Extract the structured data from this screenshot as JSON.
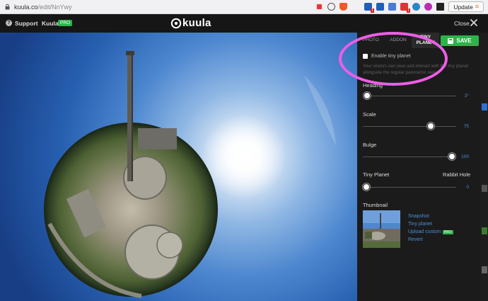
{
  "browser": {
    "url_host": "kuula.co",
    "url_path": "/edit/NnYwy",
    "update_label": "Update"
  },
  "header": {
    "help_glyph": "?",
    "support": "Support",
    "kuula_label": "Kuula",
    "pro": "PRO",
    "logo_text": "kuula",
    "close": "Close"
  },
  "panel": {
    "tabs": [
      "PHOTO",
      "ADDON",
      "TINY PLANET"
    ],
    "active_tab": "TINY PLANET",
    "save": "SAVE",
    "enable_label": "Enable tiny planet",
    "description": "Your visitors can view and interact with the tiny planet alongside the regular panoramic view.",
    "heading": {
      "label": "Heading",
      "value": "3°",
      "level": 0.03
    },
    "scale": {
      "label": "Scale",
      "value": "75",
      "level": 0.75
    },
    "bulge": {
      "label": "Bulge",
      "value": "100",
      "level": 1.0
    },
    "blend": {
      "left_label": "Tiny Planet",
      "right_label": "Rabbit Hole",
      "value": "0",
      "level": 0
    },
    "thumbnail_label": "Thumbnail",
    "links": {
      "snapshot": "Snapshot",
      "tiny_planet": "Tiny planet",
      "upload_custom": "Upload custom",
      "pro": "PRO",
      "revert": "Revert"
    }
  },
  "colors": {
    "accent_green": "#2db34a",
    "link_blue": "#4a8fd8",
    "highlight": "#ee5de6"
  }
}
